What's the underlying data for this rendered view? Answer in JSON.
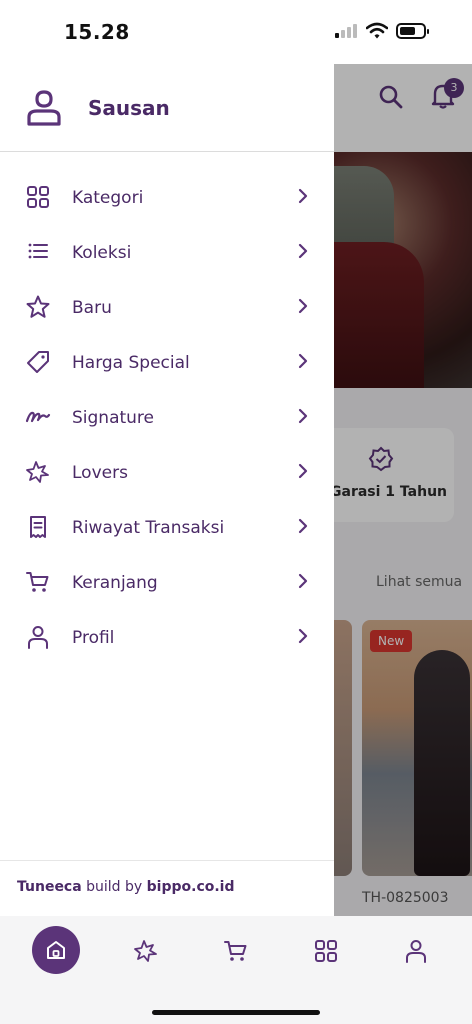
{
  "status_bar": {
    "time": "15.28"
  },
  "drawer": {
    "user_name": "Sausan",
    "menu": [
      {
        "label": "Kategori",
        "icon": "grid-icon"
      },
      {
        "label": "Koleksi",
        "icon": "list-icon"
      },
      {
        "label": "Baru",
        "icon": "star-icon"
      },
      {
        "label": "Harga Special",
        "icon": "tag-icon"
      },
      {
        "label": "Signature",
        "icon": "signature-icon"
      },
      {
        "label": "Lovers",
        "icon": "sparkle-star-icon"
      },
      {
        "label": "Riwayat Transaksi",
        "icon": "receipt-icon"
      },
      {
        "label": "Keranjang",
        "icon": "cart-icon"
      },
      {
        "label": "Profil",
        "icon": "user-icon"
      }
    ],
    "footer": {
      "brand": "Tuneeca",
      "middle": " build by ",
      "domain": "bippo.co.id"
    }
  },
  "background": {
    "notification_count": "3",
    "feature_label": "Garasi 1 Tahun",
    "see_all": "Lihat semua",
    "new_badge": "New",
    "product_sku": "TH-0825003"
  },
  "bottom_nav": [
    "home-icon",
    "sparkle-star-icon",
    "cart-icon",
    "grid-icon",
    "user-icon"
  ],
  "colors": {
    "accent": "#5b3479",
    "text": "#4a2a66",
    "badge": "#d8352e"
  }
}
